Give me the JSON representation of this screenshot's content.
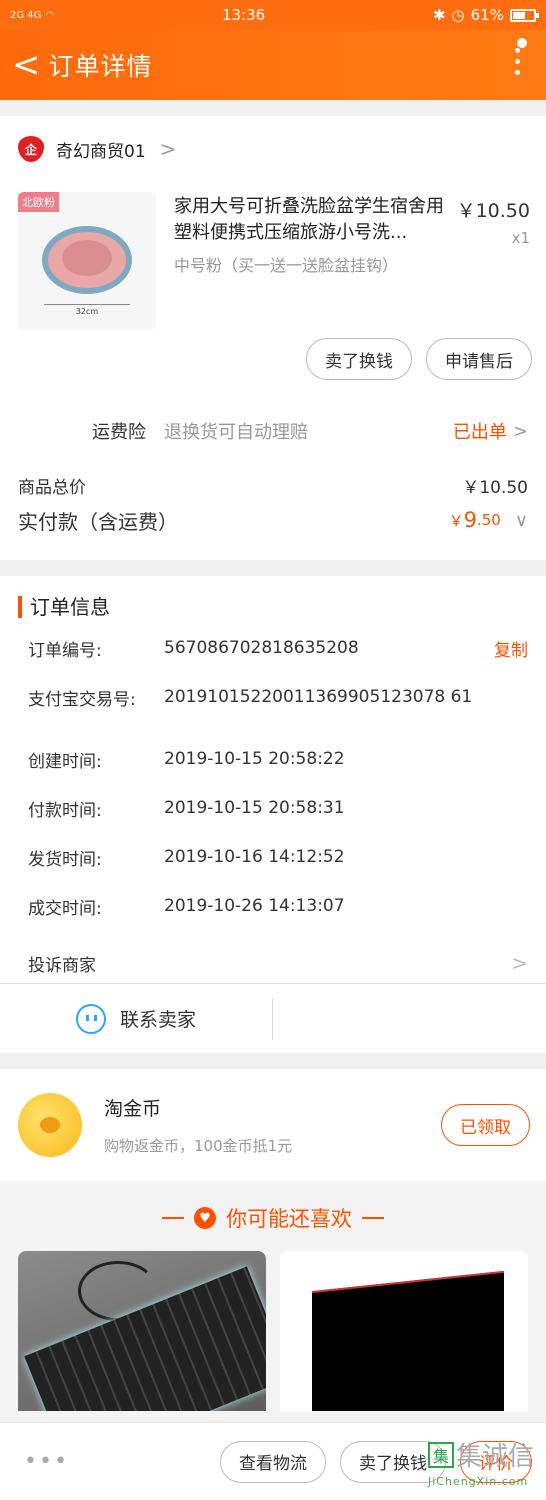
{
  "status": {
    "signal_left": "2G 4G",
    "time": "13:36",
    "battery": "61%",
    "battery_level": 0.61
  },
  "nav": {
    "back": "<",
    "title": "订单详情"
  },
  "shop": {
    "name": "奇幻商贸01",
    "logo_text": "企",
    "chevron": ">"
  },
  "item": {
    "tag": "北欧粉",
    "dimension": "32cm",
    "name": "家用大号可折叠洗脸盆学生宿舍用塑料便携式压缩旅游小号洗...",
    "spec": "中号粉（买一送一送脸盆挂钩）",
    "price": "￥10.50",
    "qty": "x1"
  },
  "item_buttons": {
    "exchange": "卖了换钱",
    "after_sale": "申请售后"
  },
  "freight": {
    "label": "运费险",
    "desc": "退换货可自动理赔",
    "status": "已出单",
    "chevron": ">"
  },
  "summary": {
    "total_label": "商品总价",
    "total_value": "￥10.50",
    "paid_label": "实付款（含运费）",
    "paid_currency": "￥",
    "paid_int": "9",
    "paid_dec": ".50",
    "toggle": "∨"
  },
  "order_info": {
    "title": "订单信息",
    "rows": [
      {
        "label": "订单编号:",
        "value": "567086702818635208",
        "action": "复制"
      },
      {
        "label": "支付宝交易号:",
        "value": "20191015220011369905123078 61"
      },
      {
        "label": "创建时间:",
        "value": "2019-10-15 20:58:22"
      },
      {
        "label": "付款时间:",
        "value": "2019-10-15 20:58:31"
      },
      {
        "label": "发货时间:",
        "value": "2019-10-16 14:12:52"
      },
      {
        "label": "成交时间:",
        "value": "2019-10-26 14:13:07"
      }
    ],
    "complain": "投诉商家",
    "chevron": ">"
  },
  "contact": {
    "label": "联系卖家"
  },
  "coin": {
    "title": "淘金币",
    "desc": "购物返金币，100金币抵1元",
    "button": "已领取"
  },
  "recommend": {
    "title": "你可能还喜欢"
  },
  "bottom": {
    "dots": "•••",
    "logistics": "查看物流",
    "exchange": "卖了换钱",
    "review": "评价"
  },
  "watermark": {
    "text": "集诚信",
    "url": "JiChengXin.com",
    "mark": "集"
  },
  "colors": {
    "accent": "#ff5000",
    "nav": "#ff6d0f",
    "link_blue": "#2aa8f2"
  }
}
